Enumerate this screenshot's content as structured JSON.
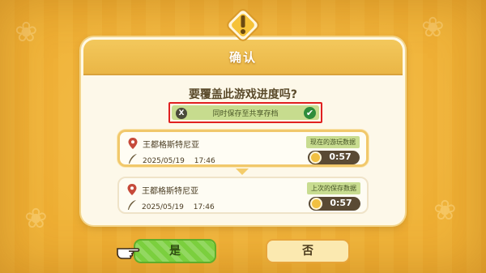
{
  "dialog": {
    "title": "确认",
    "question": "要覆盖此游戏进度吗?",
    "shared_save": {
      "button_icon": "X",
      "label": "同时保存至共享存档",
      "checked": true
    }
  },
  "saves": [
    {
      "location": "王都格斯特尼亚",
      "datetime": "2025/05/19　 17:46",
      "tag": "现在的游玩数据",
      "playtime": "0:57"
    },
    {
      "location": "王都格斯特尼亚",
      "datetime": "2025/05/19　 17:46",
      "tag": "上次的保存数据",
      "playtime": "0:57"
    }
  ],
  "buttons": {
    "yes": "是",
    "no": "否"
  },
  "colors": {
    "header": "#eab646",
    "accent_green": "#7bcf3e",
    "highlight_red": "#e02020",
    "tag_green": "#c8dc90"
  },
  "icons": {
    "alert": "exclamation-badge-icon",
    "location": "map-pin-icon",
    "datetime": "quill-pen-icon",
    "playtime": "clock-icon",
    "cursor": "pointing-hand-icon"
  }
}
